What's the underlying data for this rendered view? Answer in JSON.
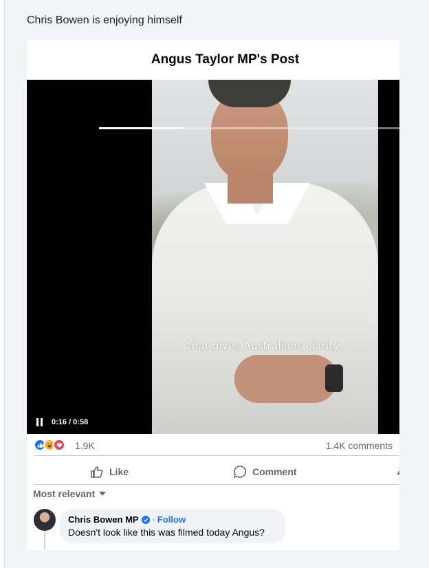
{
  "caption": "Chris Bowen is enjoying himself",
  "post": {
    "title": "Angus Taylor MP's Post"
  },
  "video": {
    "subtitle": "that gives Australians clarity,",
    "timecode": "0:16 / 0:58",
    "progress": 0.276,
    "icon": "pause-icon"
  },
  "reactions": {
    "icons": [
      "like-icon",
      "haha-icon",
      "love-icon"
    ],
    "count": "1.9K",
    "comments": "1.4K comments"
  },
  "actions": {
    "like": "Like",
    "comment": "Comment"
  },
  "sort": {
    "label": "Most relevant"
  },
  "comment": {
    "author": "Chris Bowen MP",
    "separator": "·",
    "follow": "Follow",
    "text": "Doesn't look like this was filmed today Angus?"
  },
  "colors": {
    "accent": "#1877f2",
    "muted": "#65676b",
    "love": "#f33e58",
    "haha": "#f7b928"
  }
}
